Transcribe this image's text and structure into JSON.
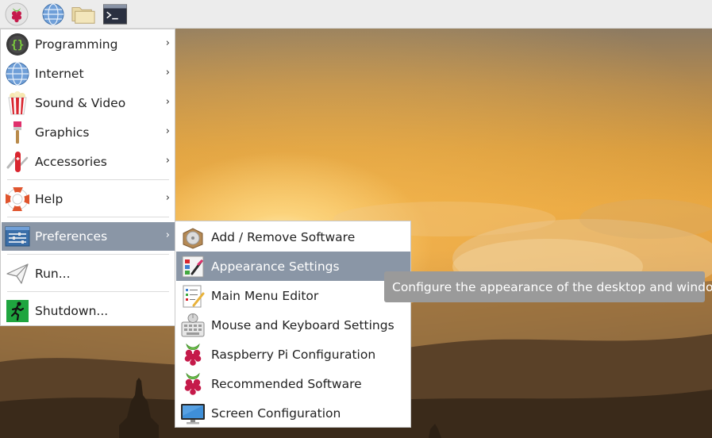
{
  "panel": {
    "launchers": [
      {
        "icon": "raspberry-pi-menu-icon"
      },
      {
        "icon": "web-browser-icon"
      },
      {
        "icon": "file-manager-icon"
      },
      {
        "icon": "terminal-icon"
      }
    ]
  },
  "menu": {
    "items": [
      {
        "label": "Programming",
        "icon": "programming-icon",
        "has_submenu": true
      },
      {
        "label": "Internet",
        "icon": "internet-globe-icon",
        "has_submenu": true
      },
      {
        "label": "Sound & Video",
        "icon": "popcorn-icon",
        "has_submenu": true
      },
      {
        "label": "Graphics",
        "icon": "paintbrush-icon",
        "has_submenu": true
      },
      {
        "label": "Accessories",
        "icon": "pocket-knife-icon",
        "has_submenu": true
      },
      {
        "label": "Help",
        "icon": "lifebuoy-icon",
        "has_submenu": true
      },
      {
        "label": "Preferences",
        "icon": "preferences-sliders-icon",
        "has_submenu": true,
        "active": true
      },
      {
        "label": "Run...",
        "icon": "paper-plane-icon",
        "has_submenu": false
      },
      {
        "label": "Shutdown...",
        "icon": "exit-running-man-icon",
        "has_submenu": false
      }
    ],
    "submenu_arrow": "›"
  },
  "submenu": {
    "items": [
      {
        "label": "Add / Remove Software",
        "icon": "software-package-icon"
      },
      {
        "label": "Appearance Settings",
        "icon": "appearance-palette-icon",
        "active": true
      },
      {
        "label": "Main Menu Editor",
        "icon": "menu-editor-icon"
      },
      {
        "label": "Mouse and Keyboard Settings",
        "icon": "mouse-keyboard-icon"
      },
      {
        "label": "Raspberry Pi Configuration",
        "icon": "raspberry-icon"
      },
      {
        "label": "Recommended Software",
        "icon": "raspberry-icon"
      },
      {
        "label": "Screen Configuration",
        "icon": "monitor-icon"
      }
    ]
  },
  "tooltip": {
    "text": "Configure the appearance of the desktop and windows"
  },
  "colors": {
    "highlight": "#8a96a6",
    "panel": "#ececec",
    "raspberry": "#c51a4a",
    "leaf": "#6cc04a"
  }
}
